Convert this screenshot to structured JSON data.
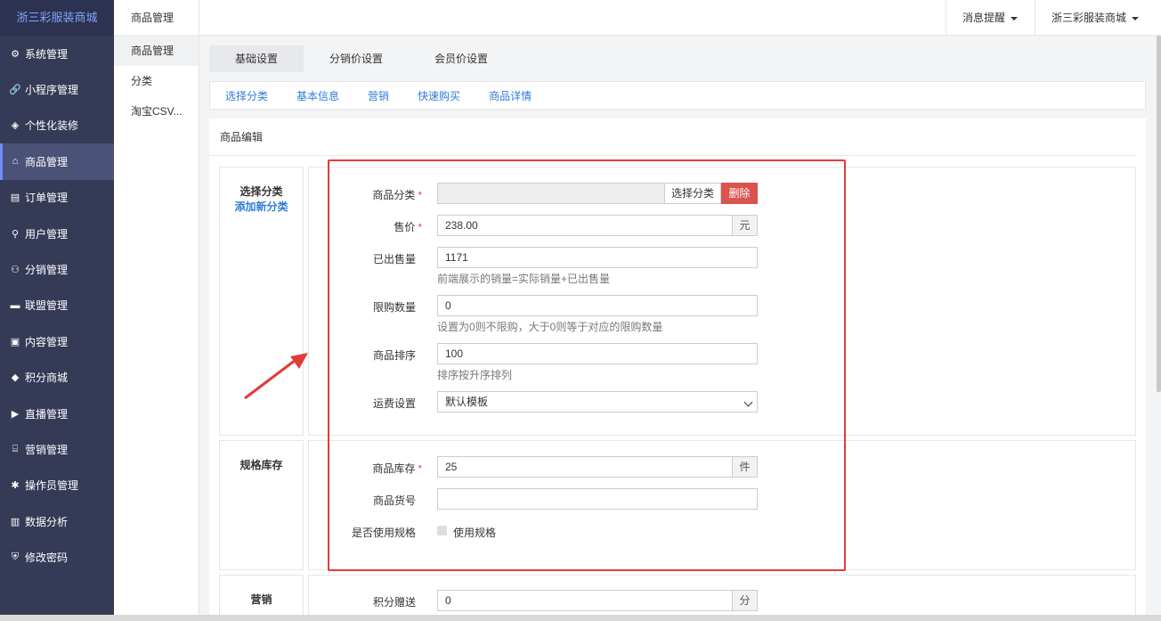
{
  "app": {
    "brand": "浙三彩服装商城"
  },
  "sidebar": {
    "items": [
      {
        "label": "系统管理",
        "icon": "gear-icon"
      },
      {
        "label": "小程序管理",
        "icon": "link-icon"
      },
      {
        "label": "个性化装修",
        "icon": "diamond-icon"
      },
      {
        "label": "商品管理",
        "icon": "shop-icon",
        "active": true
      },
      {
        "label": "订单管理",
        "icon": "order-icon"
      },
      {
        "label": "用户管理",
        "icon": "user-icon"
      },
      {
        "label": "分销管理",
        "icon": "sitemap-icon"
      },
      {
        "label": "联盟管理",
        "icon": "store-icon"
      },
      {
        "label": "内容管理",
        "icon": "newspaper-icon"
      },
      {
        "label": "积分商城",
        "icon": "cube-icon"
      },
      {
        "label": "直播管理",
        "icon": "play-icon"
      },
      {
        "label": "营销管理",
        "icon": "gift-icon"
      },
      {
        "label": "操作员管理",
        "icon": "cog-icon"
      },
      {
        "label": "数据分析",
        "icon": "bar-chart-icon"
      },
      {
        "label": "修改密码",
        "icon": "shield-icon"
      }
    ]
  },
  "subnav": {
    "title": "商品管理",
    "items": [
      "商品管理",
      "分类",
      "淘宝CSV..."
    ]
  },
  "topbar": {
    "messages": "消息提醒",
    "account": "浙三彩服装商城"
  },
  "tabs": [
    "基础设置",
    "分销价设置",
    "会员价设置"
  ],
  "anchors": [
    "选择分类",
    "基本信息",
    "营销",
    "快速购买",
    "商品详情"
  ],
  "panel": {
    "title": "商品编辑",
    "section1": {
      "label": "选择分类",
      "link": "添加新分类"
    },
    "section2": {
      "label": "规格库存"
    },
    "section3": {
      "label": "营销"
    }
  },
  "form": {
    "category": {
      "label": "商品分类",
      "value": "",
      "choose": "选择分类",
      "delete": "删除"
    },
    "price": {
      "label": "售价",
      "value": "238.00",
      "unit": "元"
    },
    "sold": {
      "label": "已出售量",
      "value": "1171",
      "help": "前端展示的销量=实际销量+已出售量"
    },
    "limit": {
      "label": "限购数量",
      "value": "0",
      "help": "设置为0则不限购，大于0则等于对应的限购数量"
    },
    "sort": {
      "label": "商品排序",
      "value": "100",
      "help": "排序按升序排列"
    },
    "shipping": {
      "label": "运费设置",
      "value": "默认模板"
    },
    "stock": {
      "label": "商品库存",
      "value": "25",
      "unit": "件"
    },
    "sku": {
      "label": "商品货号",
      "value": ""
    },
    "use_spec": {
      "label": "是否使用规格",
      "option": "使用规格"
    },
    "points": {
      "label": "积分赠送",
      "value": "0",
      "unit": "分"
    }
  },
  "colors": {
    "sidebar_bg": "#353a56",
    "accent": "#2f7cd6",
    "danger": "#d9534f",
    "highlight_box": "#e33a3a"
  }
}
